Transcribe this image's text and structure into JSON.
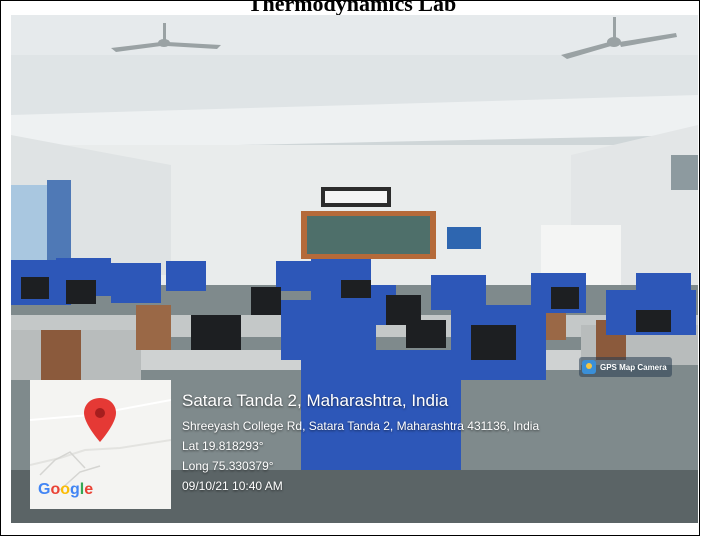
{
  "document": {
    "title": "Thermodynamics Lab"
  },
  "photo_overlay": {
    "app_badge": {
      "label": "GPS Map Camera",
      "icon": "gps-camera-icon"
    },
    "location_title": "Satara Tanda 2, Maharashtra, India",
    "address": "Shreeyash College Rd, Satara Tanda 2, Maharashtra 431136, India",
    "latitude": "Lat 19.818293°",
    "longitude": "Long 75.330379°",
    "datetime": "09/10/21 10:40 AM",
    "map": {
      "logo": [
        "G",
        "o",
        "o",
        "g",
        "l",
        "e"
      ],
      "pin_icon": "map-pin-icon",
      "pin_color": "#e53935"
    }
  }
}
